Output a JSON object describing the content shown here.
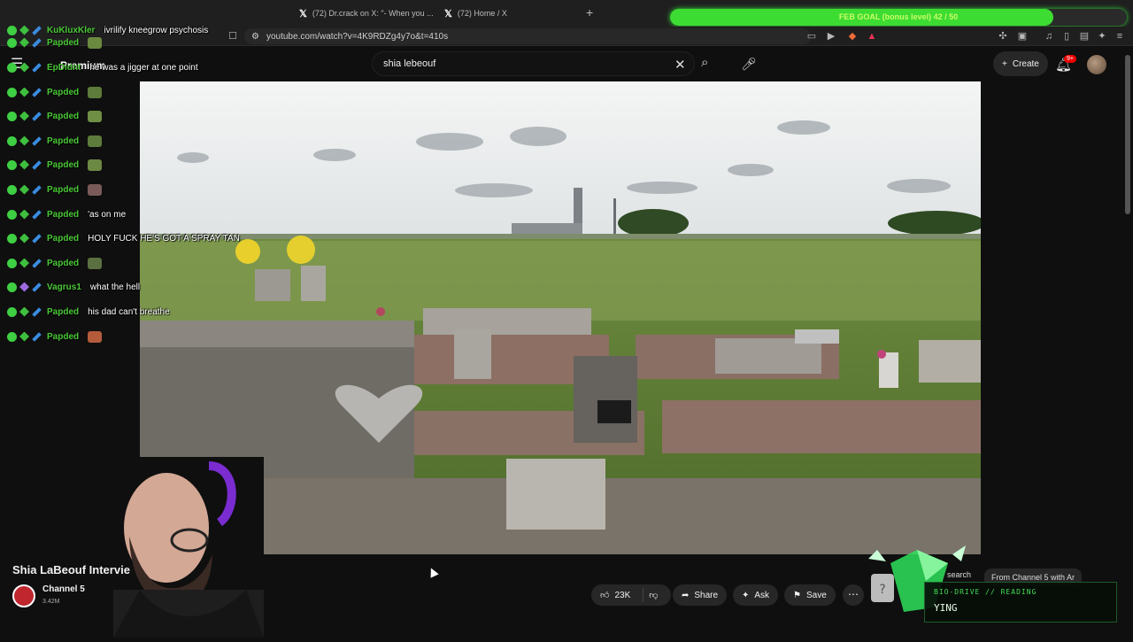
{
  "browser": {
    "tabs": [
      {
        "label": "(72) Dr.crack on X: \"- When you ...",
        "icon": "x-logo"
      },
      {
        "label": "(72) Home / X",
        "icon": "x-logo"
      }
    ],
    "new_tab_glyph": "+",
    "goal_bar": {
      "text": "FEB GOAL (bonus level) 42 / 50",
      "progress": 0.84
    },
    "url": "youtube.com/watch?v=4K9RDZg4y7o&t=410s"
  },
  "youtube": {
    "brand": "Premium",
    "search_value": "shia lebeouf",
    "create_label": "Create",
    "notification_badge": "9+"
  },
  "chat": [
    {
      "user": "KuKluxKler",
      "message": "ivrilify kneegrow psychosis",
      "emote": false
    },
    {
      "user": "Papded",
      "message": "",
      "emote": true
    },
    {
      "user": "EpDidnt",
      "message": "he was a jigger at one point",
      "emote": false
    },
    {
      "user": "Papded",
      "message": "",
      "emote": true
    },
    {
      "user": "Papded",
      "message": "",
      "emote": true
    },
    {
      "user": "Papded",
      "message": "",
      "emote": true
    },
    {
      "user": "Papded",
      "message": "",
      "emote": true
    },
    {
      "user": "Papded",
      "message": "",
      "emote": true
    },
    {
      "user": "Papded",
      "message": "'as on me",
      "emote": false
    },
    {
      "user": "Papded",
      "message": "HOLY FUCK HE'S GOT A SPRAY TAN",
      "emote": false
    },
    {
      "user": "Papded",
      "message": "",
      "emote": true
    },
    {
      "user": "Vagrus1",
      "message": "what the hell",
      "emote": false
    },
    {
      "user": "Papded",
      "message": "his dad can't breathe",
      "emote": false
    },
    {
      "user": "Papded",
      "message": "",
      "emote": true
    }
  ],
  "video": {
    "title": "Shia LaBeouf Intervie",
    "channel": "Channel 5",
    "subs": "3.42M",
    "like_count": "23K",
    "share_label": "Share",
    "ask_label": "Ask",
    "save_label": "Save",
    "chip_search": "search",
    "chip_channel": "From Channel 5 with Ar"
  },
  "bio": {
    "heading": "BIO-DRIVE // READING",
    "name": "YING"
  },
  "colors": {
    "chat_name": "#49c836",
    "goal_green": "#3ddc33",
    "yt_bg": "#0f0f0f"
  }
}
